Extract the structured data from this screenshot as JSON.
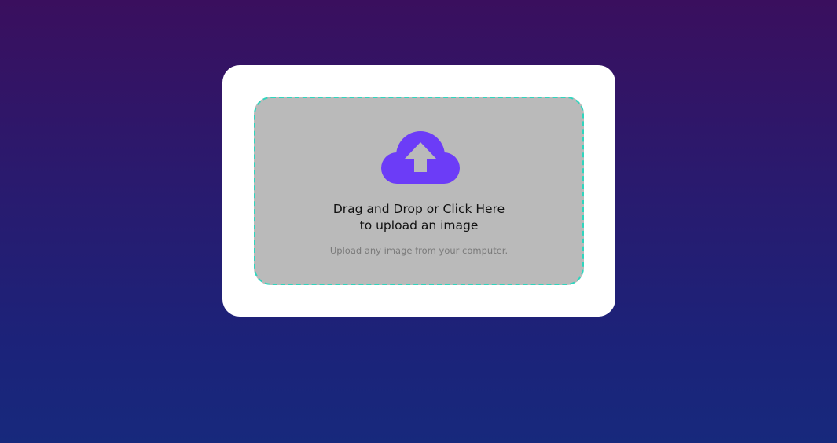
{
  "upload": {
    "title_line1": "Drag and Drop or Click Here",
    "title_line2": "to upload an image",
    "hint": "Upload any image from your computer.",
    "icon": "cloud-upload-icon"
  },
  "colors": {
    "background_top": "#3a0f5e",
    "background_bottom": "#17297c",
    "card": "#ffffff",
    "dropzone": "#bababa",
    "dropzone_border": "#2fd6be",
    "icon": "#6c3cf7"
  }
}
